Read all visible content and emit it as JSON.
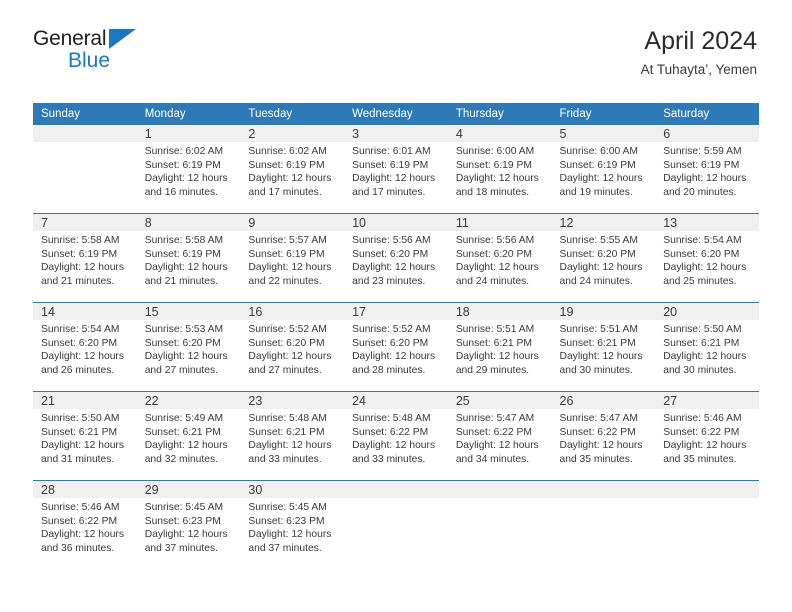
{
  "brand": {
    "word1": "General",
    "word2": "Blue"
  },
  "header": {
    "title": "April 2024",
    "subtitle": "At Tuhayta’, Yemen"
  },
  "theme": {
    "accent": "#2E7AB8",
    "band": "#EFEFEF",
    "text": "#3A3A3A",
    "logo_black": "#231F20",
    "logo_blue": "#1B77C4"
  },
  "columns": [
    "Sunday",
    "Monday",
    "Tuesday",
    "Wednesday",
    "Thursday",
    "Friday",
    "Saturday"
  ],
  "labels": {
    "sunrise_prefix": "Sunrise:",
    "sunset_prefix": "Sunset:",
    "daylight_prefix": "Daylight:"
  },
  "weeks": [
    [
      {
        "day": "",
        "line1": "",
        "line2": "",
        "line3": "",
        "line4": ""
      },
      {
        "day": "1",
        "line1": "Sunrise: 6:02 AM",
        "line2": "Sunset: 6:19 PM",
        "line3": "Daylight: 12 hours",
        "line4": "and 16 minutes."
      },
      {
        "day": "2",
        "line1": "Sunrise: 6:02 AM",
        "line2": "Sunset: 6:19 PM",
        "line3": "Daylight: 12 hours",
        "line4": "and 17 minutes."
      },
      {
        "day": "3",
        "line1": "Sunrise: 6:01 AM",
        "line2": "Sunset: 6:19 PM",
        "line3": "Daylight: 12 hours",
        "line4": "and 17 minutes."
      },
      {
        "day": "4",
        "line1": "Sunrise: 6:00 AM",
        "line2": "Sunset: 6:19 PM",
        "line3": "Daylight: 12 hours",
        "line4": "and 18 minutes."
      },
      {
        "day": "5",
        "line1": "Sunrise: 6:00 AM",
        "line2": "Sunset: 6:19 PM",
        "line3": "Daylight: 12 hours",
        "line4": "and 19 minutes."
      },
      {
        "day": "6",
        "line1": "Sunrise: 5:59 AM",
        "line2": "Sunset: 6:19 PM",
        "line3": "Daylight: 12 hours",
        "line4": "and 20 minutes."
      }
    ],
    [
      {
        "day": "7",
        "line1": "Sunrise: 5:58 AM",
        "line2": "Sunset: 6:19 PM",
        "line3": "Daylight: 12 hours",
        "line4": "and 21 minutes."
      },
      {
        "day": "8",
        "line1": "Sunrise: 5:58 AM",
        "line2": "Sunset: 6:19 PM",
        "line3": "Daylight: 12 hours",
        "line4": "and 21 minutes."
      },
      {
        "day": "9",
        "line1": "Sunrise: 5:57 AM",
        "line2": "Sunset: 6:19 PM",
        "line3": "Daylight: 12 hours",
        "line4": "and 22 minutes."
      },
      {
        "day": "10",
        "line1": "Sunrise: 5:56 AM",
        "line2": "Sunset: 6:20 PM",
        "line3": "Daylight: 12 hours",
        "line4": "and 23 minutes."
      },
      {
        "day": "11",
        "line1": "Sunrise: 5:56 AM",
        "line2": "Sunset: 6:20 PM",
        "line3": "Daylight: 12 hours",
        "line4": "and 24 minutes."
      },
      {
        "day": "12",
        "line1": "Sunrise: 5:55 AM",
        "line2": "Sunset: 6:20 PM",
        "line3": "Daylight: 12 hours",
        "line4": "and 24 minutes."
      },
      {
        "day": "13",
        "line1": "Sunrise: 5:54 AM",
        "line2": "Sunset: 6:20 PM",
        "line3": "Daylight: 12 hours",
        "line4": "and 25 minutes."
      }
    ],
    [
      {
        "day": "14",
        "line1": "Sunrise: 5:54 AM",
        "line2": "Sunset: 6:20 PM",
        "line3": "Daylight: 12 hours",
        "line4": "and 26 minutes."
      },
      {
        "day": "15",
        "line1": "Sunrise: 5:53 AM",
        "line2": "Sunset: 6:20 PM",
        "line3": "Daylight: 12 hours",
        "line4": "and 27 minutes."
      },
      {
        "day": "16",
        "line1": "Sunrise: 5:52 AM",
        "line2": "Sunset: 6:20 PM",
        "line3": "Daylight: 12 hours",
        "line4": "and 27 minutes."
      },
      {
        "day": "17",
        "line1": "Sunrise: 5:52 AM",
        "line2": "Sunset: 6:20 PM",
        "line3": "Daylight: 12 hours",
        "line4": "and 28 minutes."
      },
      {
        "day": "18",
        "line1": "Sunrise: 5:51 AM",
        "line2": "Sunset: 6:21 PM",
        "line3": "Daylight: 12 hours",
        "line4": "and 29 minutes."
      },
      {
        "day": "19",
        "line1": "Sunrise: 5:51 AM",
        "line2": "Sunset: 6:21 PM",
        "line3": "Daylight: 12 hours",
        "line4": "and 30 minutes."
      },
      {
        "day": "20",
        "line1": "Sunrise: 5:50 AM",
        "line2": "Sunset: 6:21 PM",
        "line3": "Daylight: 12 hours",
        "line4": "and 30 minutes."
      }
    ],
    [
      {
        "day": "21",
        "line1": "Sunrise: 5:50 AM",
        "line2": "Sunset: 6:21 PM",
        "line3": "Daylight: 12 hours",
        "line4": "and 31 minutes."
      },
      {
        "day": "22",
        "line1": "Sunrise: 5:49 AM",
        "line2": "Sunset: 6:21 PM",
        "line3": "Daylight: 12 hours",
        "line4": "and 32 minutes."
      },
      {
        "day": "23",
        "line1": "Sunrise: 5:48 AM",
        "line2": "Sunset: 6:21 PM",
        "line3": "Daylight: 12 hours",
        "line4": "and 33 minutes."
      },
      {
        "day": "24",
        "line1": "Sunrise: 5:48 AM",
        "line2": "Sunset: 6:22 PM",
        "line3": "Daylight: 12 hours",
        "line4": "and 33 minutes."
      },
      {
        "day": "25",
        "line1": "Sunrise: 5:47 AM",
        "line2": "Sunset: 6:22 PM",
        "line3": "Daylight: 12 hours",
        "line4": "and 34 minutes."
      },
      {
        "day": "26",
        "line1": "Sunrise: 5:47 AM",
        "line2": "Sunset: 6:22 PM",
        "line3": "Daylight: 12 hours",
        "line4": "and 35 minutes."
      },
      {
        "day": "27",
        "line1": "Sunrise: 5:46 AM",
        "line2": "Sunset: 6:22 PM",
        "line3": "Daylight: 12 hours",
        "line4": "and 35 minutes."
      }
    ],
    [
      {
        "day": "28",
        "line1": "Sunrise: 5:46 AM",
        "line2": "Sunset: 6:22 PM",
        "line3": "Daylight: 12 hours",
        "line4": "and 36 minutes."
      },
      {
        "day": "29",
        "line1": "Sunrise: 5:45 AM",
        "line2": "Sunset: 6:23 PM",
        "line3": "Daylight: 12 hours",
        "line4": "and 37 minutes."
      },
      {
        "day": "30",
        "line1": "Sunrise: 5:45 AM",
        "line2": "Sunset: 6:23 PM",
        "line3": "Daylight: 12 hours",
        "line4": "and 37 minutes."
      },
      {
        "day": "",
        "line1": "",
        "line2": "",
        "line3": "",
        "line4": ""
      },
      {
        "day": "",
        "line1": "",
        "line2": "",
        "line3": "",
        "line4": ""
      },
      {
        "day": "",
        "line1": "",
        "line2": "",
        "line3": "",
        "line4": ""
      },
      {
        "day": "",
        "line1": "",
        "line2": "",
        "line3": "",
        "line4": ""
      }
    ]
  ]
}
